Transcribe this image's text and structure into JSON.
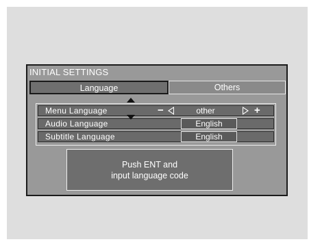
{
  "screen": {
    "title": "INITIAL SETTINGS",
    "tabs": [
      {
        "label": "Language",
        "selected": true
      },
      {
        "label": "Others",
        "selected": false
      }
    ],
    "settings": [
      {
        "label": "Menu Language",
        "value": "other",
        "minus": "−",
        "plus": "+"
      },
      {
        "label": "Audio Language",
        "value": "English"
      },
      {
        "label": "Subtitle Language",
        "value": "English"
      }
    ],
    "message": {
      "line1": "Push ENT and",
      "line2": "input language code"
    }
  },
  "colors": {
    "page_background": "#dedede",
    "screen_background": "#999999",
    "row_background": "#6a6a6a",
    "text": "#ffffff"
  },
  "icons": [
    "up-arrow-icon",
    "down-arrow-icon",
    "left-triangle-icon",
    "right-triangle-icon",
    "minus-icon",
    "plus-icon"
  ]
}
